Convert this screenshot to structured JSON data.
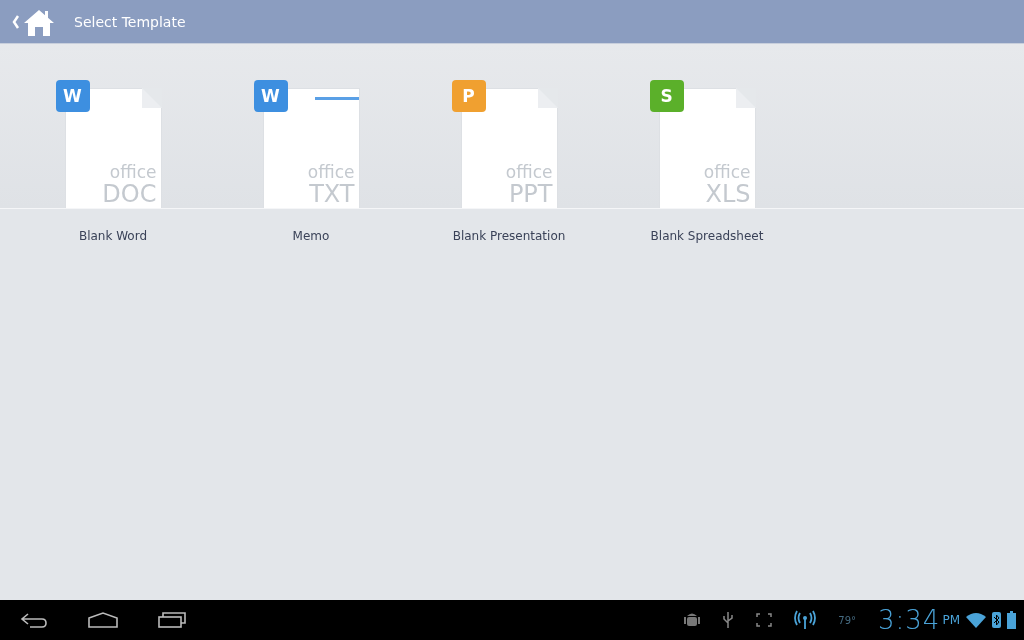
{
  "header": {
    "title": "Select Template"
  },
  "templates": [
    {
      "kind": "blank",
      "badge": "W",
      "color": "#3d8fe0",
      "brand": "office",
      "type": "DOC",
      "label": "Blank Word"
    },
    {
      "kind": "memo",
      "badge": "W",
      "color": "#3d8fe0",
      "brand": "office",
      "type": "TXT",
      "label": "Memo"
    },
    {
      "kind": "blank",
      "badge": "P",
      "color": "#f0a030",
      "brand": "office",
      "type": "PPT",
      "label": "Blank Presentation"
    },
    {
      "kind": "blank",
      "badge": "S",
      "color": "#5bb02a",
      "brand": "office",
      "type": "XLS",
      "label": "Blank Spreadsheet"
    }
  ],
  "status_bar": {
    "temperature": "79°",
    "time": "3:34",
    "ampm": "PM"
  }
}
